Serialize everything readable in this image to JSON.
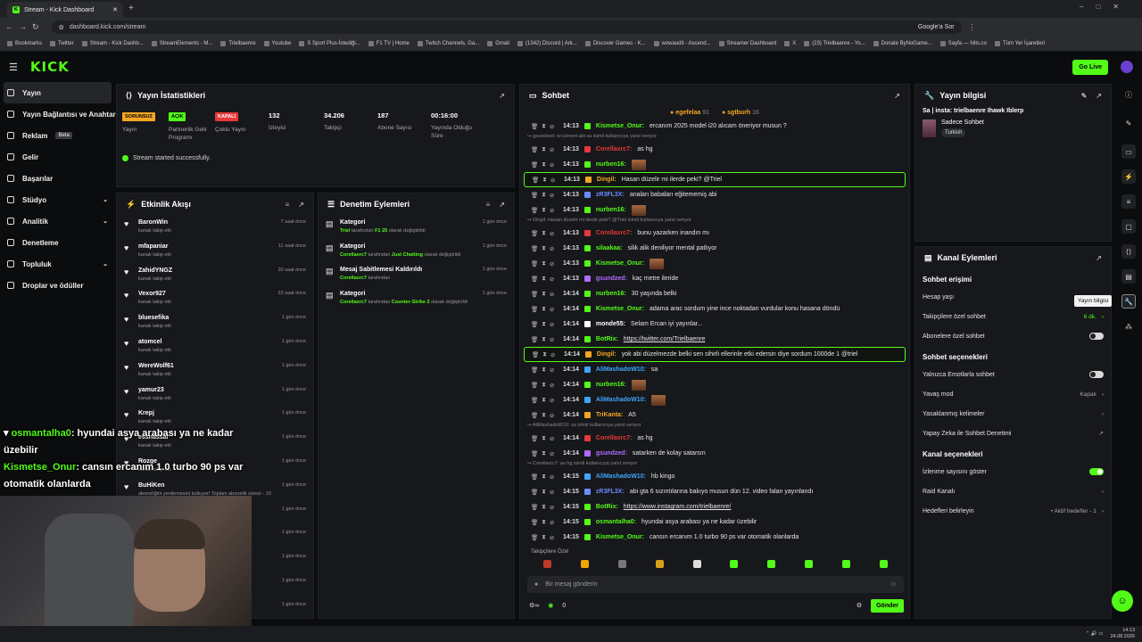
{
  "browser": {
    "tab_title": "Stream - Kick Dashboard",
    "url": "dashboard.kick.com/stream",
    "search_engine": "Google'a Sor",
    "bookmarks": [
      "Bookmarks",
      "Twitter",
      "Stream - Kick Dashb...",
      "StreamElements - M...",
      "Trielbaenre",
      "Youtube",
      "S Sport Plus-İstediği...",
      "F1 TV | Home",
      "Twitch Channels, Ga...",
      "Gmail",
      "(1342) Discord | Ark...",
      "Discover Games - K...",
      "wowaudit - Ascend...",
      "Streamer Dashboard",
      "X",
      "(23) Trielbaenre - Yo...",
      "Donate ByNoGame...",
      "Sayfa — hiits.co",
      "Tüm Yer İşaretleri"
    ]
  },
  "header": {
    "logo": "KICK",
    "go_live": "Go Live"
  },
  "sidebar": [
    {
      "label": "Yayın",
      "active": true
    },
    {
      "label": "Yayın Bağlantısı ve Anahtar"
    },
    {
      "label": "Reklam",
      "beta": "Beta"
    },
    {
      "label": "Gelir"
    },
    {
      "label": "Başarılar"
    },
    {
      "label": "Stüdyo",
      "chevron": "⌄"
    },
    {
      "label": "Analitik",
      "chevron": "⌄"
    },
    {
      "label": "Denetleme"
    },
    {
      "label": "Topluluk",
      "chevron": "⌄"
    },
    {
      "label": "Droplar ve ödüller"
    }
  ],
  "stats": {
    "title": "Yayın İstatistikleri",
    "success": "Stream started successfully.",
    "items": [
      {
        "badge": "SORUNSUZ",
        "badge_color": "#f5a623",
        "label": "Yayın"
      },
      {
        "badge": "AÇIK",
        "badge_color": "#53fc18",
        "label": "Partnerlik Gelir Programı"
      },
      {
        "badge": "KAPALI",
        "badge_color": "#e5383b",
        "label": "Çoklu Yayın"
      },
      {
        "value": "132",
        "label": "İzleyici"
      },
      {
        "value": "34.206",
        "label": "Takipçi"
      },
      {
        "value": "187",
        "label": "Abone Sayısı"
      },
      {
        "value": "00:16:00",
        "label": "Yayında Olduğu Süre"
      }
    ]
  },
  "activity": {
    "title": "Etkinlik Akışı",
    "items": [
      {
        "name": "BaronWin",
        "desc": "kanalı takip etti",
        "time": "7 saat önce"
      },
      {
        "name": "mfapaniar",
        "desc": "kanalı takip etti",
        "time": "11 saat önce"
      },
      {
        "name": "ZahidYNGZ",
        "desc": "kanalı takip etti",
        "time": "20 saat önce"
      },
      {
        "name": "Vexor927",
        "desc": "kanalı takip etti",
        "time": "23 saat önce"
      },
      {
        "name": "bluesefika",
        "desc": "kanalı takip etti",
        "time": "1 gün önce"
      },
      {
        "name": "atomcel",
        "desc": "kanalı takip etti",
        "time": "1 gün önce"
      },
      {
        "name": "WereWolf61",
        "desc": "kanalı takip etti",
        "time": "1 gün önce"
      },
      {
        "name": "yamur23",
        "desc": "kanalı takip etti",
        "time": "1 gün önce"
      },
      {
        "name": "Krepj",
        "desc": "kanalı takip etti",
        "time": "1 gün önce"
      },
      {
        "name": "essnassal",
        "desc": "kanalı takip etti",
        "time": "1 gün önce"
      },
      {
        "name": "Rozge",
        "desc": "kanalı takip etti",
        "time": "1 gün önce"
      },
      {
        "name": "BuHiKen",
        "desc": "aboneliğini yenilemesini kutluyor! Toplam abonelik süresi - 10 ay!",
        "time": "1 gün önce"
      },
      {
        "name": "",
        "desc": "",
        "time": "1 gün önce"
      },
      {
        "name": "",
        "desc": "",
        "time": "1 gün önce"
      },
      {
        "name": "",
        "desc": "",
        "time": "1 gün önce"
      },
      {
        "name": "",
        "desc": "",
        "time": "1 gün önce"
      },
      {
        "name": "",
        "desc": "",
        "time": "1 gün önce"
      }
    ]
  },
  "modlog": {
    "title": "Denetim Eylemleri",
    "items": [
      {
        "name": "Kategori",
        "user": "Triel",
        "mid": "tarafından",
        "target": "F1 25",
        "tail": "olarak değiştirildi",
        "time": "1 gün önce"
      },
      {
        "name": "Kategori",
        "user": "Corellaxrc7",
        "mid": "tarafından",
        "target": "Just Chatting",
        "tail": "olarak değiştirildi",
        "time": "1 gün önce"
      },
      {
        "name": "Mesaj Sabitlemesi Kaldırıldı",
        "user": "Corellaxrc7",
        "mid": "tarafından",
        "target": "",
        "tail": "",
        "time": "1 gün önce"
      },
      {
        "name": "Kategori",
        "user": "Corellaxrc7",
        "mid": "tarafından",
        "target": "Counter-Strike 2",
        "tail": "olarak değiştirildi",
        "time": "1 gün önce"
      }
    ]
  },
  "chat": {
    "title": "Sohbet",
    "pinned": [
      {
        "name": "egefelaa",
        "count": "91"
      },
      {
        "name": "sgtburh",
        "count": "16"
      }
    ],
    "placeholder": "Bir mesaj gönderin",
    "send": "Gönder",
    "followers_only": "Takipçilere Özel",
    "footer_count": "0",
    "messages": [
      {
        "t": "14:13",
        "u": "Kismetse_Onur",
        "c": "#53fc18",
        "m": "ercanım 2025 model i20 alıcam öneriyor musun ?"
      },
      {
        "reply": "gsundzed: ercüment abi sa isimli kullanıcıya yanıt veriyor"
      },
      {
        "t": "14:13",
        "u": "Corellaxrc7",
        "c": "#e5383b",
        "m": "as hg"
      },
      {
        "t": "14:13",
        "u": "nurben16",
        "c": "#53fc18",
        "m": "[emote]"
      },
      {
        "t": "14:13",
        "u": "Dingil",
        "c": "#f5a623",
        "m": "Hasan düzelir mi ilerde peki? @Triel",
        "hl": true
      },
      {
        "t": "14:13",
        "u": "zR3FL3X",
        "c": "#6b8cff",
        "m": "anaları babaları eğitememiş abi"
      },
      {
        "t": "14:13",
        "u": "nurben16",
        "c": "#53fc18",
        "m": "[emote]"
      },
      {
        "reply": "Dingil: Hasan düzelir mi ilerde peki? @Triel isimli kullanıcıya yanıt veriyor"
      },
      {
        "t": "14:13",
        "u": "Corellaxrc7",
        "c": "#e5383b",
        "m": "bunu yazarken inandın mı"
      },
      {
        "t": "14:13",
        "u": "silaakaa",
        "c": "#53fc18",
        "m": "silik alik deniliyor mental patlıyor"
      },
      {
        "t": "14:13",
        "u": "Kismetse_Onur",
        "c": "#53fc18",
        "m": "[emote]"
      },
      {
        "t": "14:13",
        "u": "gsundzed",
        "c": "#b06bff",
        "m": "kaç metre ileride"
      },
      {
        "t": "14:14",
        "u": "nurben16",
        "c": "#53fc18",
        "m": "30 yaşında belki"
      },
      {
        "t": "14:14",
        "u": "Kismetse_Onur",
        "c": "#53fc18",
        "m": "adama arac sordum yine ince noktadan vurdular konu hasana döndü"
      },
      {
        "t": "14:14",
        "u": "monde55",
        "c": "#ffffff",
        "m": "Selam Ercan iyi yayınlar..."
      },
      {
        "t": "14:14",
        "u": "BotRix",
        "c": "#53fc18",
        "m": "https://twitter.com/Trielbaenre",
        "link": true
      },
      {
        "t": "14:14",
        "u": "Dingil",
        "c": "#f5a623",
        "m": "yok abi düzelmezde belki sen sihirli ellerinle etki edersin diye sordum 1000de 1 @triel",
        "hl": true
      },
      {
        "t": "14:14",
        "u": "AliMashadoW10",
        "c": "#3ea6ff",
        "m": "sa"
      },
      {
        "t": "14:14",
        "u": "nurben16",
        "c": "#53fc18",
        "m": "[emote]"
      },
      {
        "t": "14:14",
        "u": "AliMashadoW10",
        "c": "#3ea6ff",
        "m": "[emote]"
      },
      {
        "t": "14:14",
        "u": "TriKanta",
        "c": "#f5a623",
        "m": "A5"
      },
      {
        "reply": "AliMashadoW10: sa isimli kullanıcıya yanıt veriyor"
      },
      {
        "t": "14:14",
        "u": "Corellaxrc7",
        "c": "#e5383b",
        "m": "as hg"
      },
      {
        "t": "14:14",
        "u": "gsundzed",
        "c": "#b06bff",
        "m": "satarken de kolay satarsın"
      },
      {
        "reply": "Corellaxrc7: as hg isimli kullanıcıya yanıt veriyor"
      },
      {
        "t": "14:15",
        "u": "AliMashadoW10",
        "c": "#3ea6ff",
        "m": "hb kingo"
      },
      {
        "t": "14:15",
        "u": "zR3FL3X",
        "c": "#6b8cff",
        "m": "abi gta 6 sızıntılarına bakıyo musun dün 12. video falan yayınlandı"
      },
      {
        "t": "14:15",
        "u": "BotRix",
        "c": "#53fc18",
        "m": "https://www.instagram.com/trielbaenre/",
        "link": true
      },
      {
        "t": "14:15",
        "u": "osmantalha0",
        "c": "#53fc18",
        "m": "hyundai asya arabası ya ne kadar üzebilir"
      },
      {
        "t": "14:15",
        "u": "Kismetse_Onur",
        "c": "#53fc18",
        "m": "cansın ercanım 1.0 turbo 90 ps var otomatik olanlarda"
      }
    ]
  },
  "info": {
    "title": "Yayın bilgisi",
    "stream_title": "Sa | insta: trielbaenre Ihawk Iblerp",
    "category": "Sadece Sohbet",
    "tag": "Turkish"
  },
  "actions": {
    "title": "Kanal Eylemleri",
    "tooltip": "Yayın bilgisi",
    "s1": "Sohbet erişimi",
    "s2": "Sohbet seçenekleri",
    "s3": "Kanal seçenekleri",
    "o": [
      {
        "label": "Hesap yaşı",
        "value": ""
      },
      {
        "label": "Takipçilere özel sohbet",
        "value": "6 dk."
      },
      {
        "label": "Abonelere özel sohbet"
      },
      {
        "label": "Yalnızca Emotlarla sohbet"
      },
      {
        "label": "Yavaş mod",
        "value": "Kapalı"
      },
      {
        "label": "Yasaklanmış kelimeler"
      },
      {
        "label": "Yapay Zeka ile Sohbet Denetimi"
      },
      {
        "label": "İzlenme sayısını göster"
      },
      {
        "label": "Raid Kanalı"
      },
      {
        "label": "Hedefleri belirleyin",
        "value": "• Aktif hedefler - 1"
      }
    ]
  },
  "overlay": {
    "u1": "osmantalha0",
    "m1": ": hyundai asya arabası ya ne kadar üzebilir",
    "u2": "Kismetse_Onur",
    "m2": ": cansın ercanım 1.0 turbo 90 ps var otomatik olanlarda"
  },
  "taskbar": {
    "time": "14:13",
    "date": "24.08.2026"
  }
}
